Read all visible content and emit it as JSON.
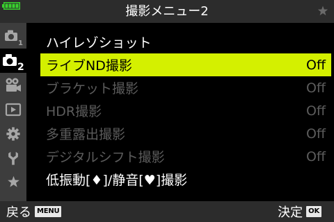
{
  "colors": {
    "highlight": "#d4f000",
    "text": "#ffffff",
    "disabled_text": "#5c5c5c",
    "sidebar_bg": "#3d3d3d",
    "bar_bg": "#2c2c2c",
    "icon": "#a6a6a6",
    "battery": "#39d12e",
    "star": "#6a6a6a"
  },
  "status_bar": {
    "battery_icon": "battery-icon",
    "battery_level": 1.0,
    "title": "撮影メニュー2",
    "right_icon": "star-icon"
  },
  "sidebar": {
    "tabs": [
      {
        "icon": "camera-icon",
        "badge": "1",
        "selected": false
      },
      {
        "icon": "camera-icon",
        "badge": "2",
        "selected": true
      },
      {
        "icon": "video-camera-icon",
        "selected": false
      },
      {
        "icon": "playback-icon",
        "selected": false
      },
      {
        "icon": "gear-icon",
        "selected": false
      },
      {
        "icon": "wrench-icon",
        "selected": false
      },
      {
        "icon": "star-icon",
        "selected": false
      }
    ]
  },
  "menu": {
    "items": [
      {
        "label": "ハイレゾショット",
        "state": "enabled"
      },
      {
        "label": "ライブND撮影",
        "value": "Off",
        "state": "selected"
      },
      {
        "label": "ブラケット撮影",
        "value": "Off",
        "state": "disabled"
      },
      {
        "label": "HDR撮影",
        "value": "Off",
        "state": "disabled"
      },
      {
        "label": "多重露出撮影",
        "value": "Off",
        "state": "disabled"
      },
      {
        "label": "デジタルシフト撮影",
        "value": "Off",
        "state": "disabled"
      },
      {
        "label": "低振動[♦]/静音[♥]撮影",
        "state": "enabled"
      }
    ]
  },
  "footer": {
    "back_label": "戻る",
    "back_key": "MENU",
    "ok_label": "決定",
    "ok_key": "OK"
  }
}
